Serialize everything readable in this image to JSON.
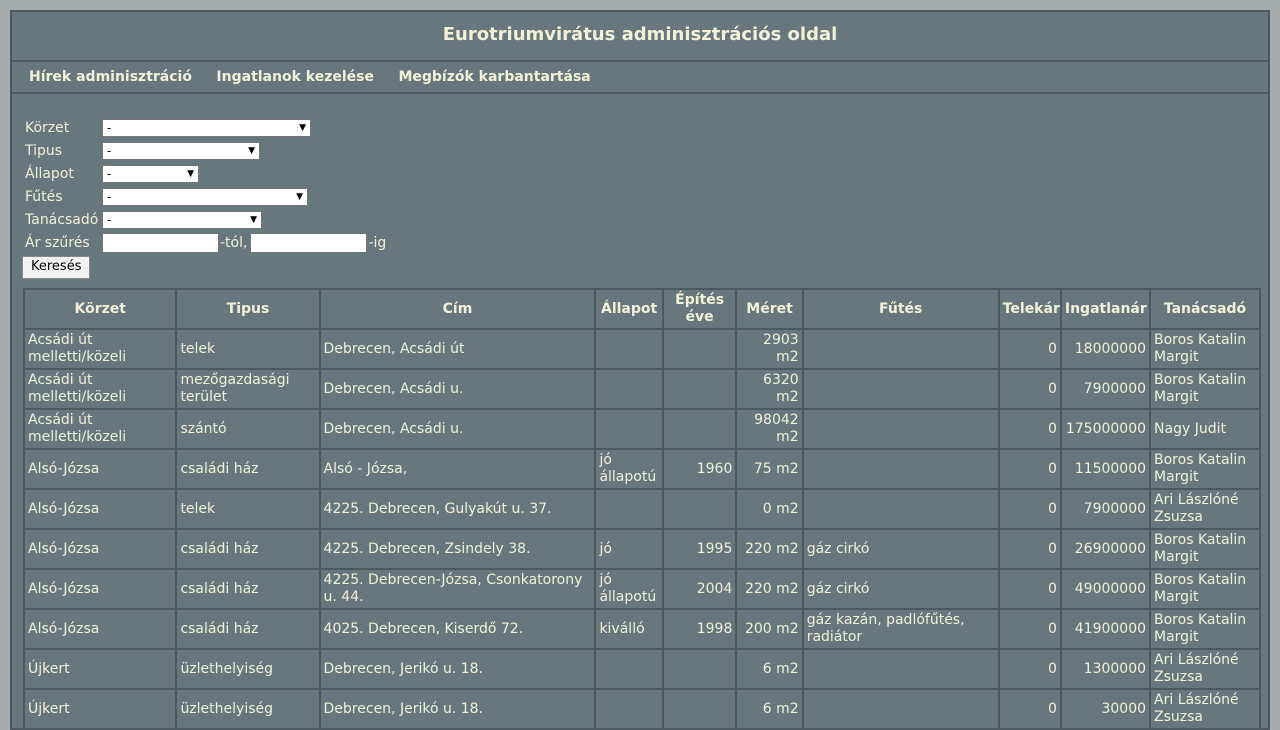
{
  "header": {
    "title": "Eurotriumvirátus adminisztrációs oldal"
  },
  "nav": [
    {
      "label": "Hírek adminisztráció"
    },
    {
      "label": "Ingatlanok kezelése"
    },
    {
      "label": "Megbízók karbantartása"
    }
  ],
  "filters": {
    "korzet": {
      "label": "Körzet",
      "value": "-"
    },
    "tipus": {
      "label": "Tipus",
      "value": "-"
    },
    "allapot": {
      "label": "Állapot",
      "value": "-"
    },
    "futes": {
      "label": "Fűtés",
      "value": "-"
    },
    "tanacsado": {
      "label": "Tanácsadó",
      "value": "-"
    },
    "ar": {
      "label": "Ár szűrés",
      "from_suffix": "-tól,",
      "to_suffix": "-ig",
      "from_value": "",
      "to_value": ""
    },
    "search_button": "Keresés"
  },
  "table": {
    "headers": [
      "Körzet",
      "Tipus",
      "Cím",
      "Állapot",
      "Építés éve",
      "Méret",
      "Fűtés",
      "Telekár",
      "Ingatlanár",
      "Tanácsadó"
    ],
    "rows": [
      [
        "Acsádi út melletti/közeli",
        "telek",
        "Debrecen, Acsádi út",
        "",
        "",
        "2903 m2",
        "",
        "0",
        "18000000",
        "Boros Katalin Margit"
      ],
      [
        "Acsádi út melletti/közeli",
        "mezőgazdasági terület",
        "Debrecen, Acsádi u.",
        "",
        "",
        "6320 m2",
        "",
        "0",
        "7900000",
        "Boros Katalin Margit"
      ],
      [
        "Acsádi út melletti/közeli",
        "szántó",
        "Debrecen, Acsádi u.",
        "",
        "",
        "98042 m2",
        "",
        "0",
        "175000000",
        "Nagy Judit"
      ],
      [
        "Alsó-Józsa",
        "családi ház",
        "Alsó - Józsa,",
        "jó állapotú",
        "1960",
        "75 m2",
        "",
        "0",
        "11500000",
        "Boros Katalin Margit"
      ],
      [
        "Alsó-Józsa",
        "telek",
        "4225. Debrecen, Gulyakút u. 37.",
        "",
        "",
        "0 m2",
        "",
        "0",
        "7900000",
        "Ari Lászlóné Zsuzsa"
      ],
      [
        "Alsó-Józsa",
        "családi ház",
        "4225. Debrecen, Zsindely 38.",
        "jó",
        "1995",
        "220 m2",
        "gáz cirkó",
        "0",
        "26900000",
        "Boros Katalin Margit"
      ],
      [
        "Alsó-Józsa",
        "családi ház",
        "4225. Debrecen-Józsa, Csonkatorony u. 44.",
        "jó állapotú",
        "2004",
        "220 m2",
        "gáz cirkó",
        "0",
        "49000000",
        "Boros Katalin Margit"
      ],
      [
        "Alsó-Józsa",
        "családi ház",
        "4025. Debrecen, Kiserdő 72.",
        "kiválló",
        "1998",
        "200 m2",
        "gáz kazán, padlófűtés, radiátor",
        "0",
        "41900000",
        "Boros Katalin Margit"
      ],
      [
        "Újkert",
        "üzlethelyiség",
        "Debrecen, Jerikó u. 18.",
        "",
        "",
        "6 m2",
        "",
        "0",
        "1300000",
        "Ari Lászlóné Zsuzsa"
      ],
      [
        "Újkert",
        "üzlethelyiség",
        "Debrecen, Jerikó u. 18.",
        "",
        "",
        "6 m2",
        "",
        "0",
        "30000",
        "Ari Lászlóné Zsuzsa"
      ]
    ]
  }
}
